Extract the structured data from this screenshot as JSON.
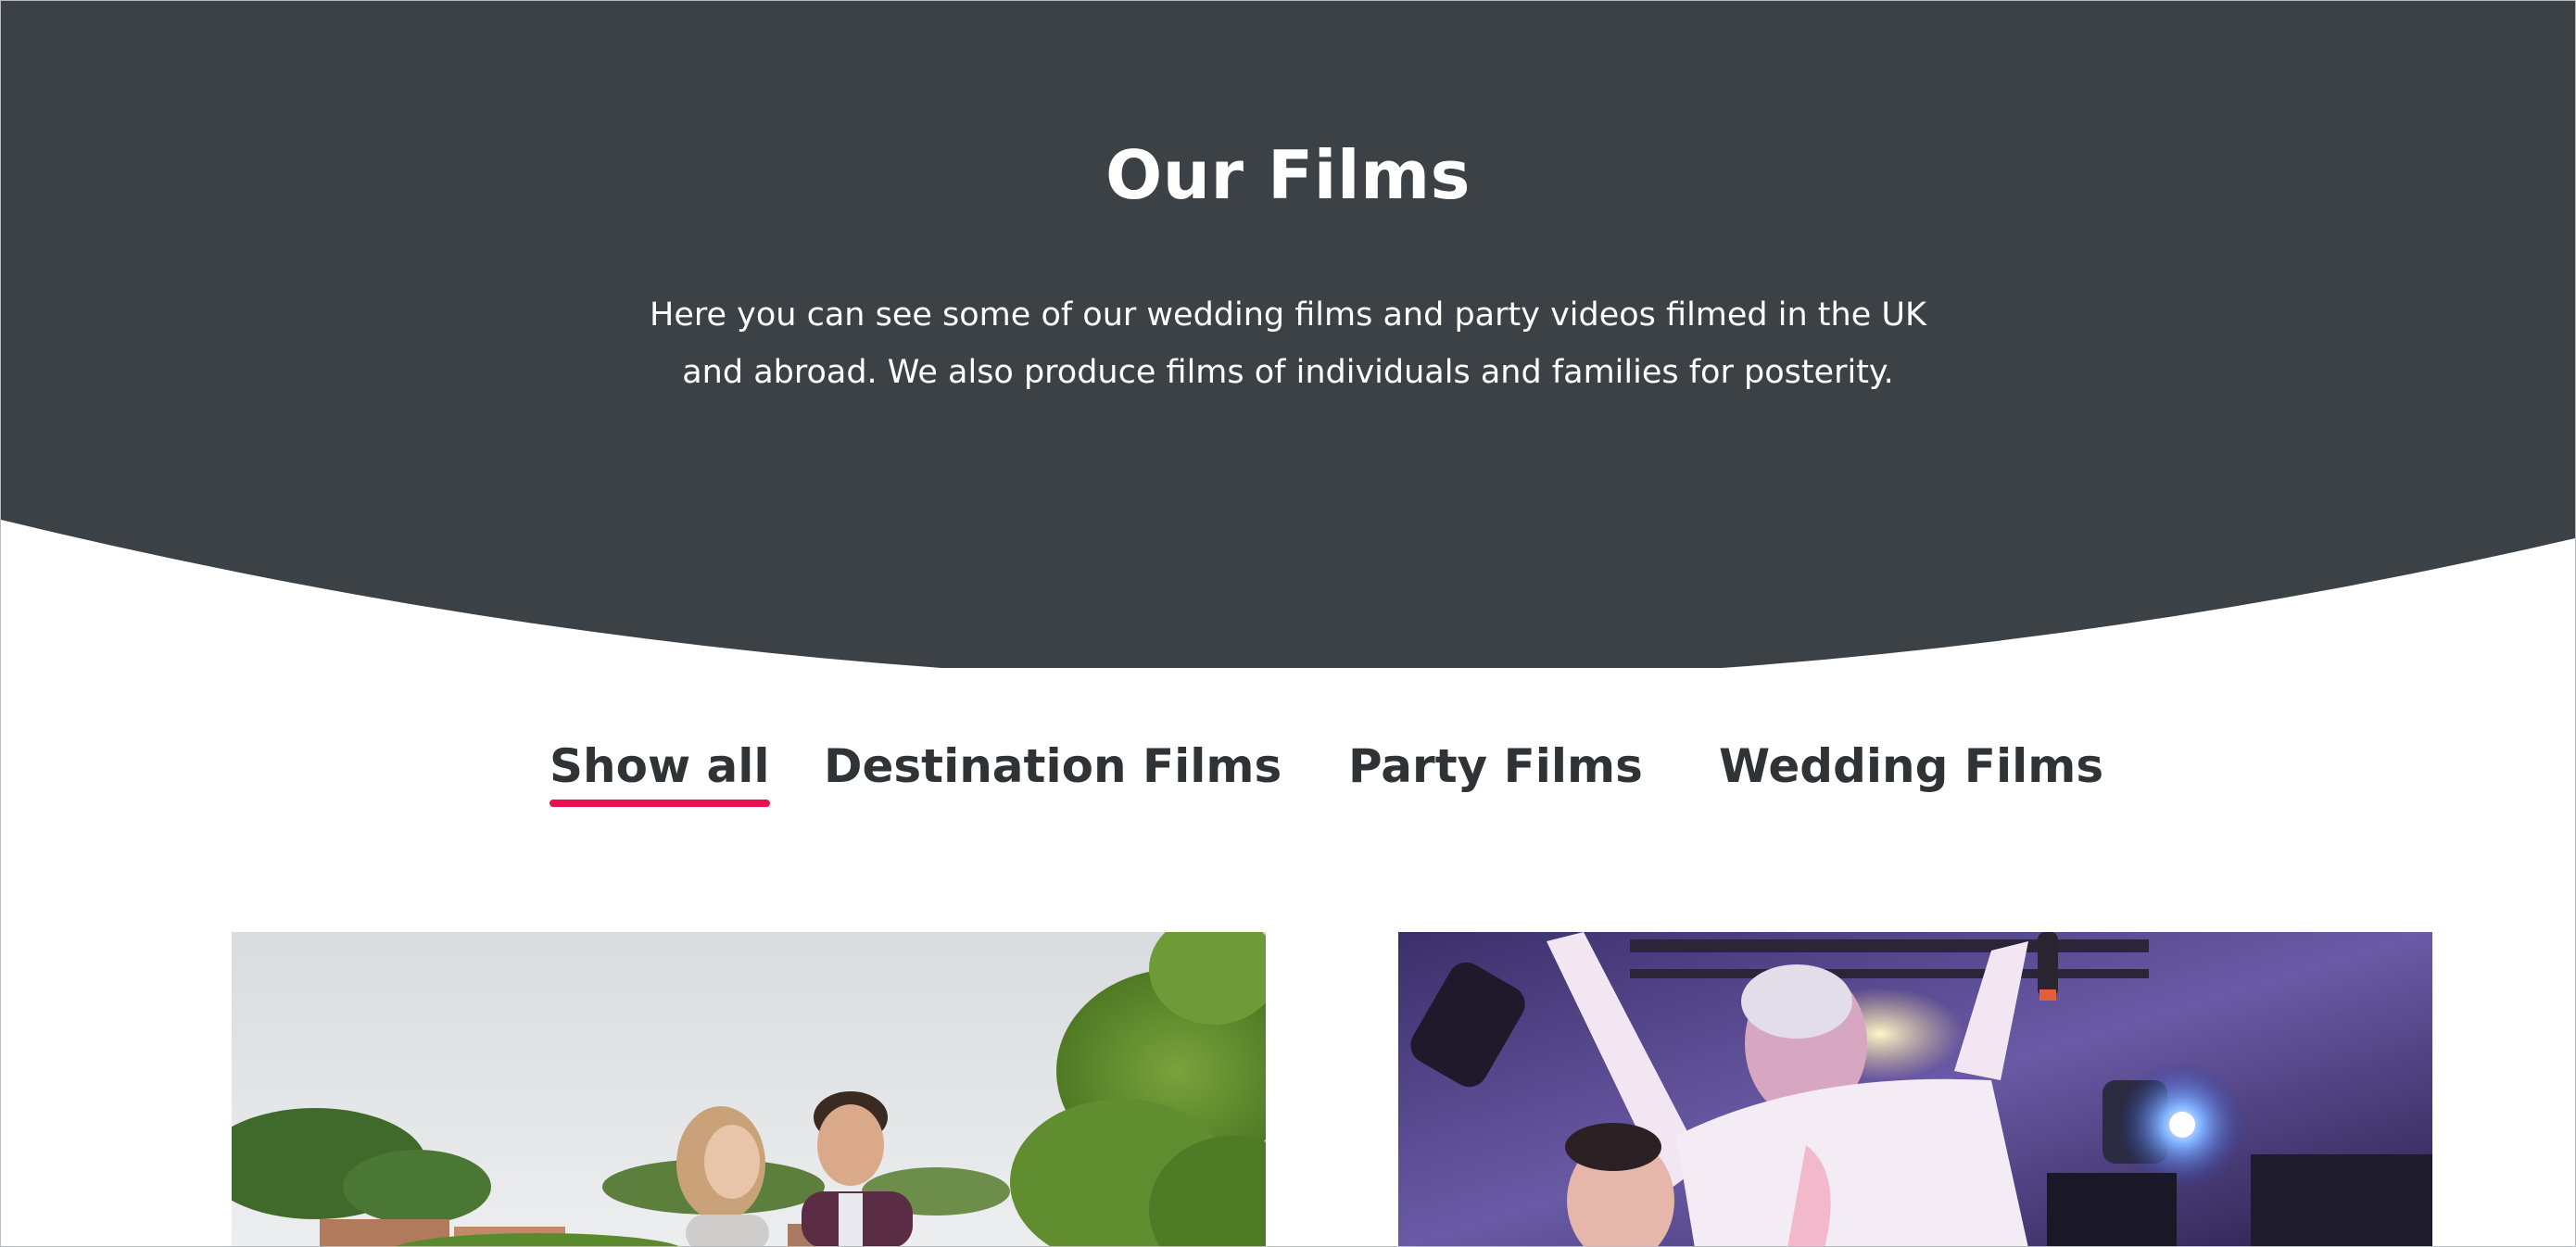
{
  "hero": {
    "title": "Our Films",
    "description_line1": "Here you can see some of our wedding films and party videos filmed in the UK",
    "description_line2": "and abroad. We also produce films of individuals and families for posterity."
  },
  "filters": {
    "items": [
      {
        "label": "Show all",
        "active": true
      },
      {
        "label": "Destination Films",
        "active": false
      },
      {
        "label": "Party Films",
        "active": false
      },
      {
        "label": "Wedding Films",
        "active": false
      }
    ]
  },
  "films": [
    {
      "thumbnail": "couple-in-vineyard-photo"
    },
    {
      "thumbnail": "man-celebrating-at-party-photo"
    }
  ],
  "colors": {
    "hero_background": "#3b4145",
    "accent": "#e8104f",
    "filter_text": "#2f3336",
    "page_background": "#ffffff"
  }
}
